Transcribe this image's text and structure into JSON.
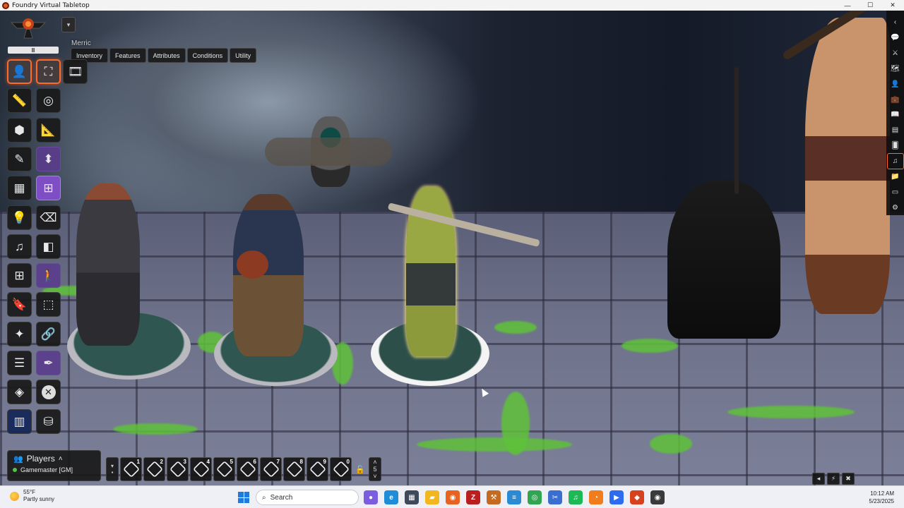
{
  "window": {
    "title": "Foundry Virtual Tabletop",
    "controls": [
      "—",
      "☐",
      "✕"
    ]
  },
  "scene_menu": {
    "pause_label": "II",
    "dropdown_icon": "▾",
    "scene_name": "Merric"
  },
  "token_tabs": [
    "Inventory",
    "Features",
    "Attributes",
    "Conditions",
    "Utility"
  ],
  "tools": {
    "col1": [
      {
        "name": "token-controls",
        "icon": "person-icon",
        "glyph": "👤",
        "state": "active"
      },
      {
        "name": "measure-controls",
        "icon": "ruler-icon",
        "glyph": "📏",
        "state": ""
      },
      {
        "name": "tile-controls",
        "icon": "cubes-icon",
        "glyph": "⬢",
        "state": ""
      },
      {
        "name": "drawing-controls",
        "icon": "pencil-icon",
        "glyph": "✎",
        "state": ""
      },
      {
        "name": "wall-controls",
        "icon": "bricks-icon",
        "glyph": "▦",
        "state": ""
      },
      {
        "name": "lighting-controls",
        "icon": "lightbulb-icon",
        "glyph": "💡",
        "state": ""
      },
      {
        "name": "sound-controls",
        "icon": "music-icon",
        "glyph": "♫",
        "state": ""
      },
      {
        "name": "region-controls",
        "icon": "grid-icon",
        "glyph": "⊞",
        "state": ""
      },
      {
        "name": "notes-controls",
        "icon": "bookmark-icon",
        "glyph": "🔖",
        "state": ""
      },
      {
        "name": "effects-controls",
        "icon": "magic-wand-icon",
        "glyph": "✦",
        "state": ""
      },
      {
        "name": "list-controls",
        "icon": "list-icon",
        "glyph": "☰",
        "state": ""
      },
      {
        "name": "layers-controls",
        "icon": "layers-icon",
        "glyph": "◈",
        "state": ""
      },
      {
        "name": "map-controls",
        "icon": "map-icon",
        "glyph": "▥",
        "state": "blue"
      }
    ],
    "col2": [
      {
        "name": "select-tool",
        "icon": "expand-icon",
        "glyph": "⛶",
        "state": "active"
      },
      {
        "name": "target-tool",
        "icon": "target-icon",
        "glyph": "◎",
        "state": ""
      },
      {
        "name": "ruler-tool",
        "icon": "ruler-icon",
        "glyph": "📐",
        "state": ""
      },
      {
        "name": "elevation-tool",
        "icon": "elevation-icon",
        "glyph": "⬍",
        "state": "purple"
      },
      {
        "name": "grid-tool",
        "icon": "grid-icon",
        "glyph": "⊞",
        "state": "sub-active"
      },
      {
        "name": "eraser-tool",
        "icon": "eraser-icon",
        "glyph": "⌫",
        "state": ""
      },
      {
        "name": "cube-tool",
        "icon": "cube-icon",
        "glyph": "◧",
        "state": ""
      },
      {
        "name": "walk-tool",
        "icon": "walk-icon",
        "glyph": "🚶",
        "state": "purple"
      },
      {
        "name": "transform-tool",
        "icon": "transform-icon",
        "glyph": "⬚",
        "state": ""
      },
      {
        "name": "link-tool",
        "icon": "link-icon",
        "glyph": "🔗",
        "state": ""
      },
      {
        "name": "feather-tool",
        "icon": "feather-icon",
        "glyph": "✒",
        "state": "purple"
      },
      {
        "name": "clear-tool",
        "icon": "close-circle-icon",
        "glyph": "✕",
        "state": "circle"
      },
      {
        "name": "database-tool",
        "icon": "database-icon",
        "glyph": "⛁",
        "state": ""
      }
    ],
    "col3": [
      {
        "name": "film-tool",
        "icon": "film-icon",
        "glyph": "🎞",
        "state": ""
      }
    ]
  },
  "sidebar": [
    {
      "name": "collapse",
      "icon": "chevron-left-icon",
      "glyph": "‹"
    },
    {
      "name": "chat",
      "icon": "chat-icon",
      "glyph": "💬"
    },
    {
      "name": "combat",
      "icon": "swords-icon",
      "glyph": "⚔"
    },
    {
      "name": "scenes",
      "icon": "map-icon",
      "glyph": "🗺"
    },
    {
      "name": "actors",
      "icon": "user-icon",
      "glyph": "👤"
    },
    {
      "name": "items",
      "icon": "suitcase-icon",
      "glyph": "💼"
    },
    {
      "name": "journal",
      "icon": "book-icon",
      "glyph": "📖"
    },
    {
      "name": "tables",
      "icon": "table-icon",
      "glyph": "▤"
    },
    {
      "name": "cards",
      "icon": "cards-icon",
      "glyph": "🂠"
    },
    {
      "name": "playlists",
      "icon": "music-icon",
      "glyph": "♫"
    },
    {
      "name": "compendium",
      "icon": "folder-icon",
      "glyph": "📁"
    },
    {
      "name": "notes",
      "icon": "note-icon",
      "glyph": "▭"
    },
    {
      "name": "settings",
      "icon": "gears-icon",
      "glyph": "⚙"
    }
  ],
  "players": {
    "header": "Players",
    "list": [
      {
        "name": "Gamemaster [GM]",
        "status": "online"
      }
    ]
  },
  "hotbar": {
    "slots": [
      "1",
      "2",
      "3",
      "4",
      "5",
      "6",
      "7",
      "8",
      "9",
      "0"
    ],
    "page": "5",
    "lock_icon": "🔓"
  },
  "canvas_corner": [
    "◂",
    "⚡",
    "✖"
  ],
  "taskbar": {
    "weather_temp": "55°F",
    "weather_desc": "Partly sunny",
    "search_label": "Search",
    "apps": [
      {
        "name": "copilot",
        "color": "#7b5de0",
        "glyph": "●"
      },
      {
        "name": "edge",
        "color": "#1f8cd8",
        "glyph": "e"
      },
      {
        "name": "calculator",
        "color": "#3e4a5a",
        "glyph": "▦"
      },
      {
        "name": "explorer",
        "color": "#f2b71e",
        "glyph": "▰"
      },
      {
        "name": "firefox",
        "color": "#e8631f",
        "glyph": "◉"
      },
      {
        "name": "filezilla",
        "color": "#b91f1f",
        "glyph": "Z"
      },
      {
        "name": "foundry",
        "color": "#c46b22",
        "glyph": "⚒"
      },
      {
        "name": "notepad",
        "color": "#2a8bd4",
        "glyph": "≡"
      },
      {
        "name": "chrome",
        "color": "#30a552",
        "glyph": "◎"
      },
      {
        "name": "snipping",
        "color": "#3a6fd1",
        "glyph": "✂"
      },
      {
        "name": "spotify",
        "color": "#1db954",
        "glyph": "♫"
      },
      {
        "name": "blender",
        "color": "#f07c1b",
        "glyph": "◔"
      },
      {
        "name": "zoom",
        "color": "#2d6cf0",
        "glyph": "▶"
      },
      {
        "name": "foundry-vtt",
        "color": "#d8411d",
        "glyph": "◆"
      },
      {
        "name": "obs",
        "color": "#3a3a3a",
        "glyph": "◉"
      }
    ],
    "time": "10:12 AM",
    "date": "5/23/2025"
  }
}
